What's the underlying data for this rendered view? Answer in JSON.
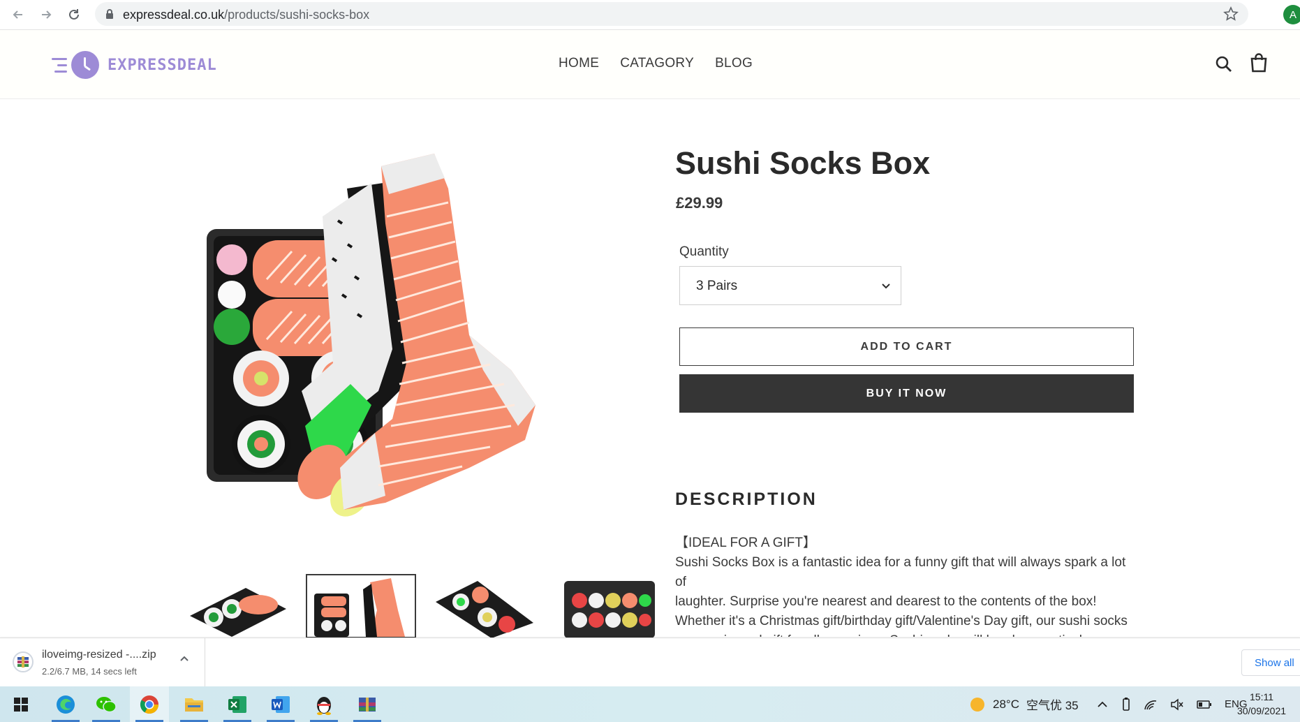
{
  "browser": {
    "url_domain": "expressdeal.co.uk",
    "url_path": "/products/sushi-socks-box",
    "profile_initial": "A"
  },
  "header": {
    "logo_text": "EXPRESSDEAL",
    "nav": [
      "HOME",
      "CATAGORY",
      "BLOG"
    ]
  },
  "product": {
    "title": "Sushi Socks Box",
    "price": "£29.99",
    "quantity_label": "Quantity",
    "quantity_value": "3 Pairs",
    "add_to_cart": "ADD TO CART",
    "buy_now": "BUY IT NOW",
    "description_heading": "DESCRIPTION",
    "description_lines": [
      "【IDEAL FOR A GIFT】",
      "Sushi Socks Box is a fantastic idea for a funny gift that will always spark a lot of",
      "laughter. Surprise you're nearest and dearest to the contents of the box!",
      "Whether it's a Christmas gift/birthday gift/Valentine's Day gift, our sushi socks",
      "are a universal gift for all occasions. Sushi socks will be also practical as a"
    ]
  },
  "download": {
    "file_name": "iloveimg-resized -....zip",
    "status": "2.2/6.7 MB, 14 secs left",
    "show_all": "Show all"
  },
  "taskbar": {
    "weather_temp": "28°C",
    "air_quality": "空气优 35",
    "language": "ENG",
    "time": "15:11",
    "date": "30/09/2021"
  },
  "colors": {
    "brand_purple": "#9d8bd6",
    "buy_button_bg": "#353535",
    "salmon": "#f58d6e",
    "sock_green": "#2ed84a"
  }
}
